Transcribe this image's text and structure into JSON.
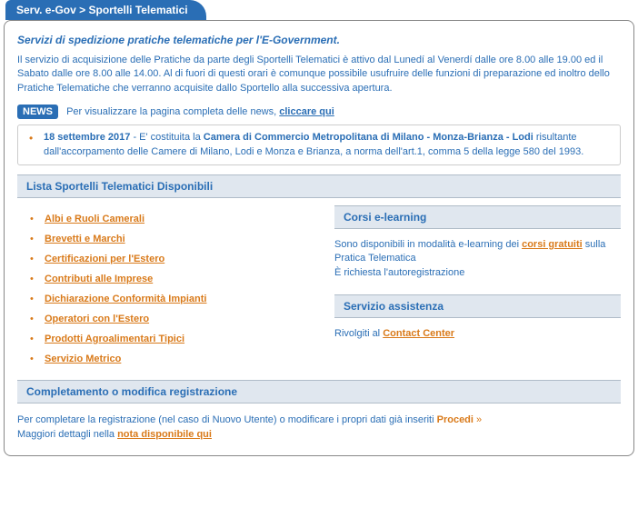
{
  "breadcrumb": "Serv. e-Gov > Sportelli Telematici",
  "subtitle": "Servizi di spedizione pratiche telematiche per l'E-Government.",
  "intro": "Il servizio di acquisizione delle Pratiche da parte degli Sportelli Telematici è attivo dal Lunedí al Venerdí dalle ore 8.00 alle 19.00 ed il Sabato dalle ore 8.00 alle 14.00. Al di fuori di questi orari è comunque possibile usufruire delle funzioni di preparazione ed inoltro dello Pratiche Telematiche che verranno acquisite dallo Sportello alla successiva apertura.",
  "news": {
    "tag": "NEWS",
    "lead": "Per visualizzare la pagina completa delle news, ",
    "link": "cliccare qui",
    "item_date": "18 settembre 2017",
    "item_pre": " - E' costituita la ",
    "item_bold": "Camera di Commercio Metropolitana di Milano - Monza-Brianza - Lodi",
    "item_post": " risultante dall'accorpamento delle Camere di Milano, Lodi e Monza e Brianza, a norma dell'art.1, comma 5 della legge 580 del 1993."
  },
  "list_header": "Lista Sportelli Telematici Disponibili",
  "links": [
    "Albi e Ruoli Camerali",
    "Brevetti e Marchi",
    "Certificazioni per l'Estero",
    "Contributi alle Imprese",
    "Dichiarazione Conformità Impianti",
    "Operatori con l'Estero",
    "Prodotti Agroalimentari Tipici",
    "Servizio Metrico"
  ],
  "elearn": {
    "header": "Corsi e-learning",
    "text1": "Sono disponibili in modalità e-learning dei ",
    "link": "corsi gratuiti",
    "text2": " sulla Pratica Telematica",
    "text3": "È richiesta l'autoregistrazione"
  },
  "assist": {
    "header": "Servizio assistenza",
    "text": "Rivolgiti al ",
    "link": "Contact Center"
  },
  "completion": {
    "header": "Completamento o modifica registrazione",
    "text1": "Per completare la registrazione (nel caso di Nuovo Utente) o modificare i propri dati già inseriti  ",
    "procedi": "Procedi",
    "arrow": " »",
    "text2": "Maggiori dettagli nella ",
    "note_link": "nota disponibile qui"
  }
}
